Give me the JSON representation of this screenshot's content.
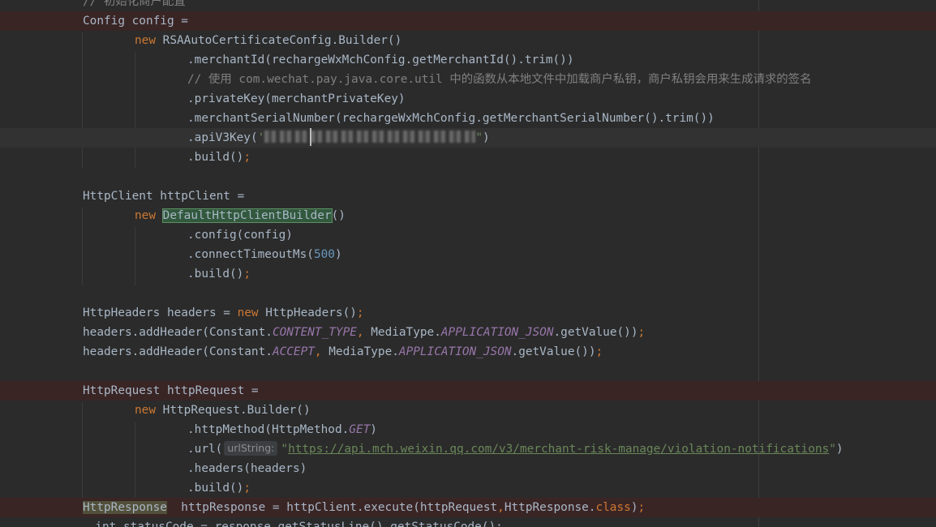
{
  "editor": {
    "comment_init": "// 初始化商户配置",
    "comment_usage": "// 使用 com.wechat.pay.java.core.util 中的函数从本地文件中加载商户私钥，商户私钥会用来生成请求的签名",
    "config_decl": "Config config =",
    "kw_new": "new",
    "rsa_builder": " RSAAutoCertificateConfig.Builder()",
    "merchant_id_line": ".merchantId(rechargeWxMchConfig.getMerchantId().trim())",
    "private_key_line": ".privateKey(merchantPrivateKey)",
    "serial_line": ".merchantSerialNumber(rechargeWxMchConfig.getMerchantSerialNumber().trim())",
    "apiv3_open": ".apiV3Key(",
    "quote_open": "'",
    "quote_close": "\"",
    "apiv3_close": ")",
    "build_call": ".build()",
    "semicolon": ";",
    "http_client_decl": "HttpClient httpClient =",
    "default_builder": "DefaultHttpClientBuilder",
    "parens": "()",
    "config_call": ".config(config)",
    "timeout_open": ".connectTimeoutMs(",
    "timeout_value": "500",
    "close_paren": ")",
    "headers_decl_a": "HttpHeaders headers = ",
    "headers_decl_b": " HttpHeaders()",
    "add_header_a": "headers.addHeader(Constant.",
    "content_type": "CONTENT_TYPE",
    "accept": "ACCEPT",
    "comma": ",",
    "media_type": " MediaType.",
    "app_json": "APPLICATION_JSON",
    "get_value": ".getValue())",
    "request_decl": "HttpRequest httpRequest =",
    "request_builder": " HttpRequest.Builder()",
    "http_method_open": ".httpMethod(HttpMethod.",
    "get_const": "GET",
    "url_open": ".url(",
    "url_hint": "urlString:",
    "url_quote": "\"",
    "url_value": "https://api.mch.weixin.qq.com/v3/merchant-risk-manage/violation-notifications",
    "headers_call": ".headers(headers)",
    "response_type": "HttpResponse",
    "response_rest_a": "  httpResponse = httpClient.execute(httpRequest",
    "response_rest_b": "HttpResponse.",
    "kw_class": "class",
    "status_line": "  int statusCode = response.getStatusLine().getStatusCode();"
  }
}
